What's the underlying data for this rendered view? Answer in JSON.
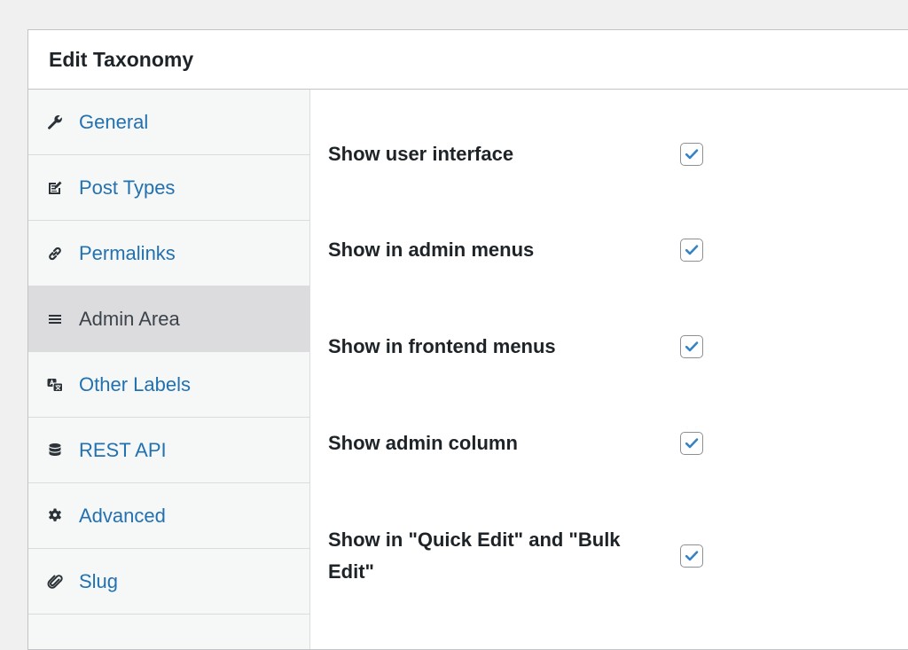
{
  "panel": {
    "title": "Edit Taxonomy"
  },
  "sidebar": {
    "items": [
      {
        "label": "General",
        "icon": "wrench-icon",
        "active": false
      },
      {
        "label": "Post Types",
        "icon": "post-types-icon",
        "active": false
      },
      {
        "label": "Permalinks",
        "icon": "link-icon",
        "active": false
      },
      {
        "label": "Admin Area",
        "icon": "menu-icon",
        "active": true
      },
      {
        "label": "Other Labels",
        "icon": "translation-icon",
        "active": false
      },
      {
        "label": "REST API",
        "icon": "database-icon",
        "active": false
      },
      {
        "label": "Advanced",
        "icon": "gear-icon",
        "active": false
      },
      {
        "label": "Slug",
        "icon": "paperclip-icon",
        "active": false
      }
    ]
  },
  "settings": {
    "rows": [
      {
        "label": "Show user interface",
        "checked": true
      },
      {
        "label": "Show in admin menus",
        "checked": true
      },
      {
        "label": "Show in frontend menus",
        "checked": true
      },
      {
        "label": "Show admin column",
        "checked": true
      },
      {
        "label": "Show in \"Quick Edit\" and \"Bulk Edit\"",
        "checked": true
      }
    ]
  },
  "colors": {
    "link": "#2271b1",
    "active_bg": "#dcdcde",
    "checkmark": "#3582c4",
    "border": "#c3c4c7"
  }
}
